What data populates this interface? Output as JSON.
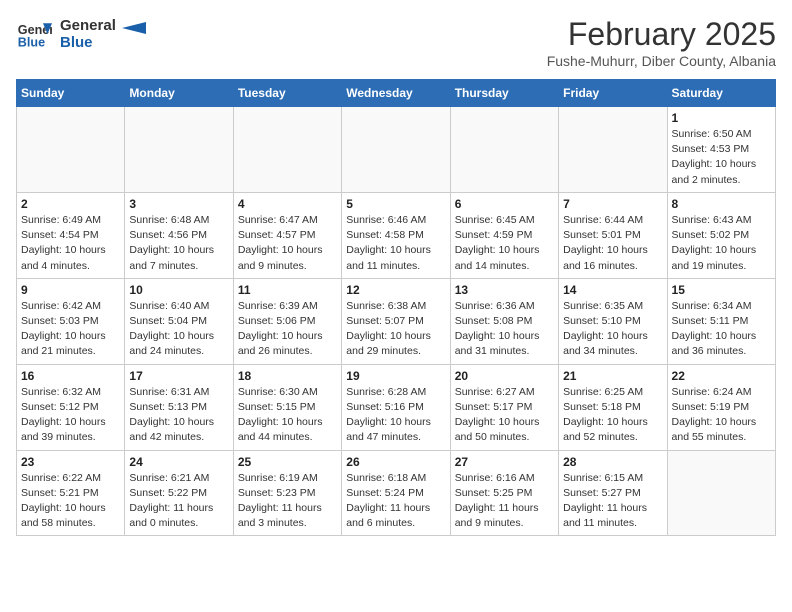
{
  "logo": {
    "line1": "General",
    "line2": "Blue"
  },
  "title": "February 2025",
  "subtitle": "Fushe-Muhurr, Diber County, Albania",
  "days_of_week": [
    "Sunday",
    "Monday",
    "Tuesday",
    "Wednesday",
    "Thursday",
    "Friday",
    "Saturday"
  ],
  "weeks": [
    [
      {
        "day": "",
        "info": ""
      },
      {
        "day": "",
        "info": ""
      },
      {
        "day": "",
        "info": ""
      },
      {
        "day": "",
        "info": ""
      },
      {
        "day": "",
        "info": ""
      },
      {
        "day": "",
        "info": ""
      },
      {
        "day": "1",
        "info": "Sunrise: 6:50 AM\nSunset: 4:53 PM\nDaylight: 10 hours and 2 minutes."
      }
    ],
    [
      {
        "day": "2",
        "info": "Sunrise: 6:49 AM\nSunset: 4:54 PM\nDaylight: 10 hours and 4 minutes."
      },
      {
        "day": "3",
        "info": "Sunrise: 6:48 AM\nSunset: 4:56 PM\nDaylight: 10 hours and 7 minutes."
      },
      {
        "day": "4",
        "info": "Sunrise: 6:47 AM\nSunset: 4:57 PM\nDaylight: 10 hours and 9 minutes."
      },
      {
        "day": "5",
        "info": "Sunrise: 6:46 AM\nSunset: 4:58 PM\nDaylight: 10 hours and 11 minutes."
      },
      {
        "day": "6",
        "info": "Sunrise: 6:45 AM\nSunset: 4:59 PM\nDaylight: 10 hours and 14 minutes."
      },
      {
        "day": "7",
        "info": "Sunrise: 6:44 AM\nSunset: 5:01 PM\nDaylight: 10 hours and 16 minutes."
      },
      {
        "day": "8",
        "info": "Sunrise: 6:43 AM\nSunset: 5:02 PM\nDaylight: 10 hours and 19 minutes."
      }
    ],
    [
      {
        "day": "9",
        "info": "Sunrise: 6:42 AM\nSunset: 5:03 PM\nDaylight: 10 hours and 21 minutes."
      },
      {
        "day": "10",
        "info": "Sunrise: 6:40 AM\nSunset: 5:04 PM\nDaylight: 10 hours and 24 minutes."
      },
      {
        "day": "11",
        "info": "Sunrise: 6:39 AM\nSunset: 5:06 PM\nDaylight: 10 hours and 26 minutes."
      },
      {
        "day": "12",
        "info": "Sunrise: 6:38 AM\nSunset: 5:07 PM\nDaylight: 10 hours and 29 minutes."
      },
      {
        "day": "13",
        "info": "Sunrise: 6:36 AM\nSunset: 5:08 PM\nDaylight: 10 hours and 31 minutes."
      },
      {
        "day": "14",
        "info": "Sunrise: 6:35 AM\nSunset: 5:10 PM\nDaylight: 10 hours and 34 minutes."
      },
      {
        "day": "15",
        "info": "Sunrise: 6:34 AM\nSunset: 5:11 PM\nDaylight: 10 hours and 36 minutes."
      }
    ],
    [
      {
        "day": "16",
        "info": "Sunrise: 6:32 AM\nSunset: 5:12 PM\nDaylight: 10 hours and 39 minutes."
      },
      {
        "day": "17",
        "info": "Sunrise: 6:31 AM\nSunset: 5:13 PM\nDaylight: 10 hours and 42 minutes."
      },
      {
        "day": "18",
        "info": "Sunrise: 6:30 AM\nSunset: 5:15 PM\nDaylight: 10 hours and 44 minutes."
      },
      {
        "day": "19",
        "info": "Sunrise: 6:28 AM\nSunset: 5:16 PM\nDaylight: 10 hours and 47 minutes."
      },
      {
        "day": "20",
        "info": "Sunrise: 6:27 AM\nSunset: 5:17 PM\nDaylight: 10 hours and 50 minutes."
      },
      {
        "day": "21",
        "info": "Sunrise: 6:25 AM\nSunset: 5:18 PM\nDaylight: 10 hours and 52 minutes."
      },
      {
        "day": "22",
        "info": "Sunrise: 6:24 AM\nSunset: 5:19 PM\nDaylight: 10 hours and 55 minutes."
      }
    ],
    [
      {
        "day": "23",
        "info": "Sunrise: 6:22 AM\nSunset: 5:21 PM\nDaylight: 10 hours and 58 minutes."
      },
      {
        "day": "24",
        "info": "Sunrise: 6:21 AM\nSunset: 5:22 PM\nDaylight: 11 hours and 0 minutes."
      },
      {
        "day": "25",
        "info": "Sunrise: 6:19 AM\nSunset: 5:23 PM\nDaylight: 11 hours and 3 minutes."
      },
      {
        "day": "26",
        "info": "Sunrise: 6:18 AM\nSunset: 5:24 PM\nDaylight: 11 hours and 6 minutes."
      },
      {
        "day": "27",
        "info": "Sunrise: 6:16 AM\nSunset: 5:25 PM\nDaylight: 11 hours and 9 minutes."
      },
      {
        "day": "28",
        "info": "Sunrise: 6:15 AM\nSunset: 5:27 PM\nDaylight: 11 hours and 11 minutes."
      },
      {
        "day": "",
        "info": ""
      }
    ]
  ]
}
